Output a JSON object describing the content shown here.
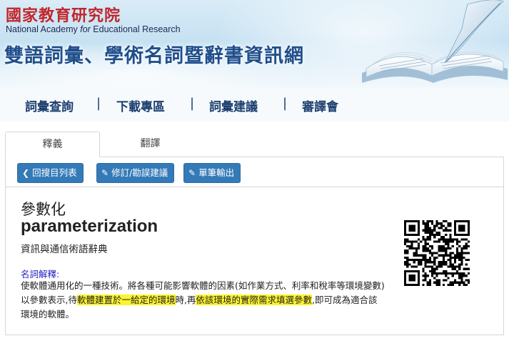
{
  "header": {
    "org_name_zh": "國家教育研究院",
    "org_name_en_prefix": "National Academy ",
    "org_name_en_italic": "for",
    "org_name_en_suffix": " Educational Research",
    "site_title": "雙語詞彙、學術名詞暨辭書資訊網"
  },
  "nav": {
    "items": [
      {
        "label": "詞彙查詢"
      },
      {
        "label": "下載專區"
      },
      {
        "label": "詞彙建議"
      },
      {
        "label": "審譯會"
      }
    ],
    "separator": "|"
  },
  "tabs": [
    {
      "label": "釋義",
      "active": true
    },
    {
      "label": "翻譯",
      "active": false
    }
  ],
  "toolbar": {
    "back_label": "回搜目列表",
    "back_icon": "chevron-left-icon",
    "correction_label": "修訂/勘誤建議",
    "correction_icon": "pencil-icon",
    "export_label": "單筆輸出",
    "export_icon": "pencil-icon"
  },
  "entry": {
    "term_zh": "參數化",
    "term_en": "parameterization",
    "source": "資訊與通信術語辭典",
    "definition_label": "名詞解釋:",
    "definition_part1": "使軟體通用化的一種技術。將各種可能影響軟體的因素(如作業方式、利率和稅率等環境變數)以參數表示,待",
    "definition_hl1": "軟體建置於一給定的環境",
    "definition_part2": "時,再",
    "definition_hl2": "依該環境的實際需求填選參數",
    "definition_part3": ",即可成為適合該環境的軟體。"
  },
  "colors": {
    "org_red": "#c0262b",
    "title_blue": "#1f4e8c",
    "nav_text": "#1c3f6e",
    "button_blue": "#337ab7",
    "highlight_yellow": "#fdf42f",
    "definition_label_blue": "#2323c8"
  }
}
